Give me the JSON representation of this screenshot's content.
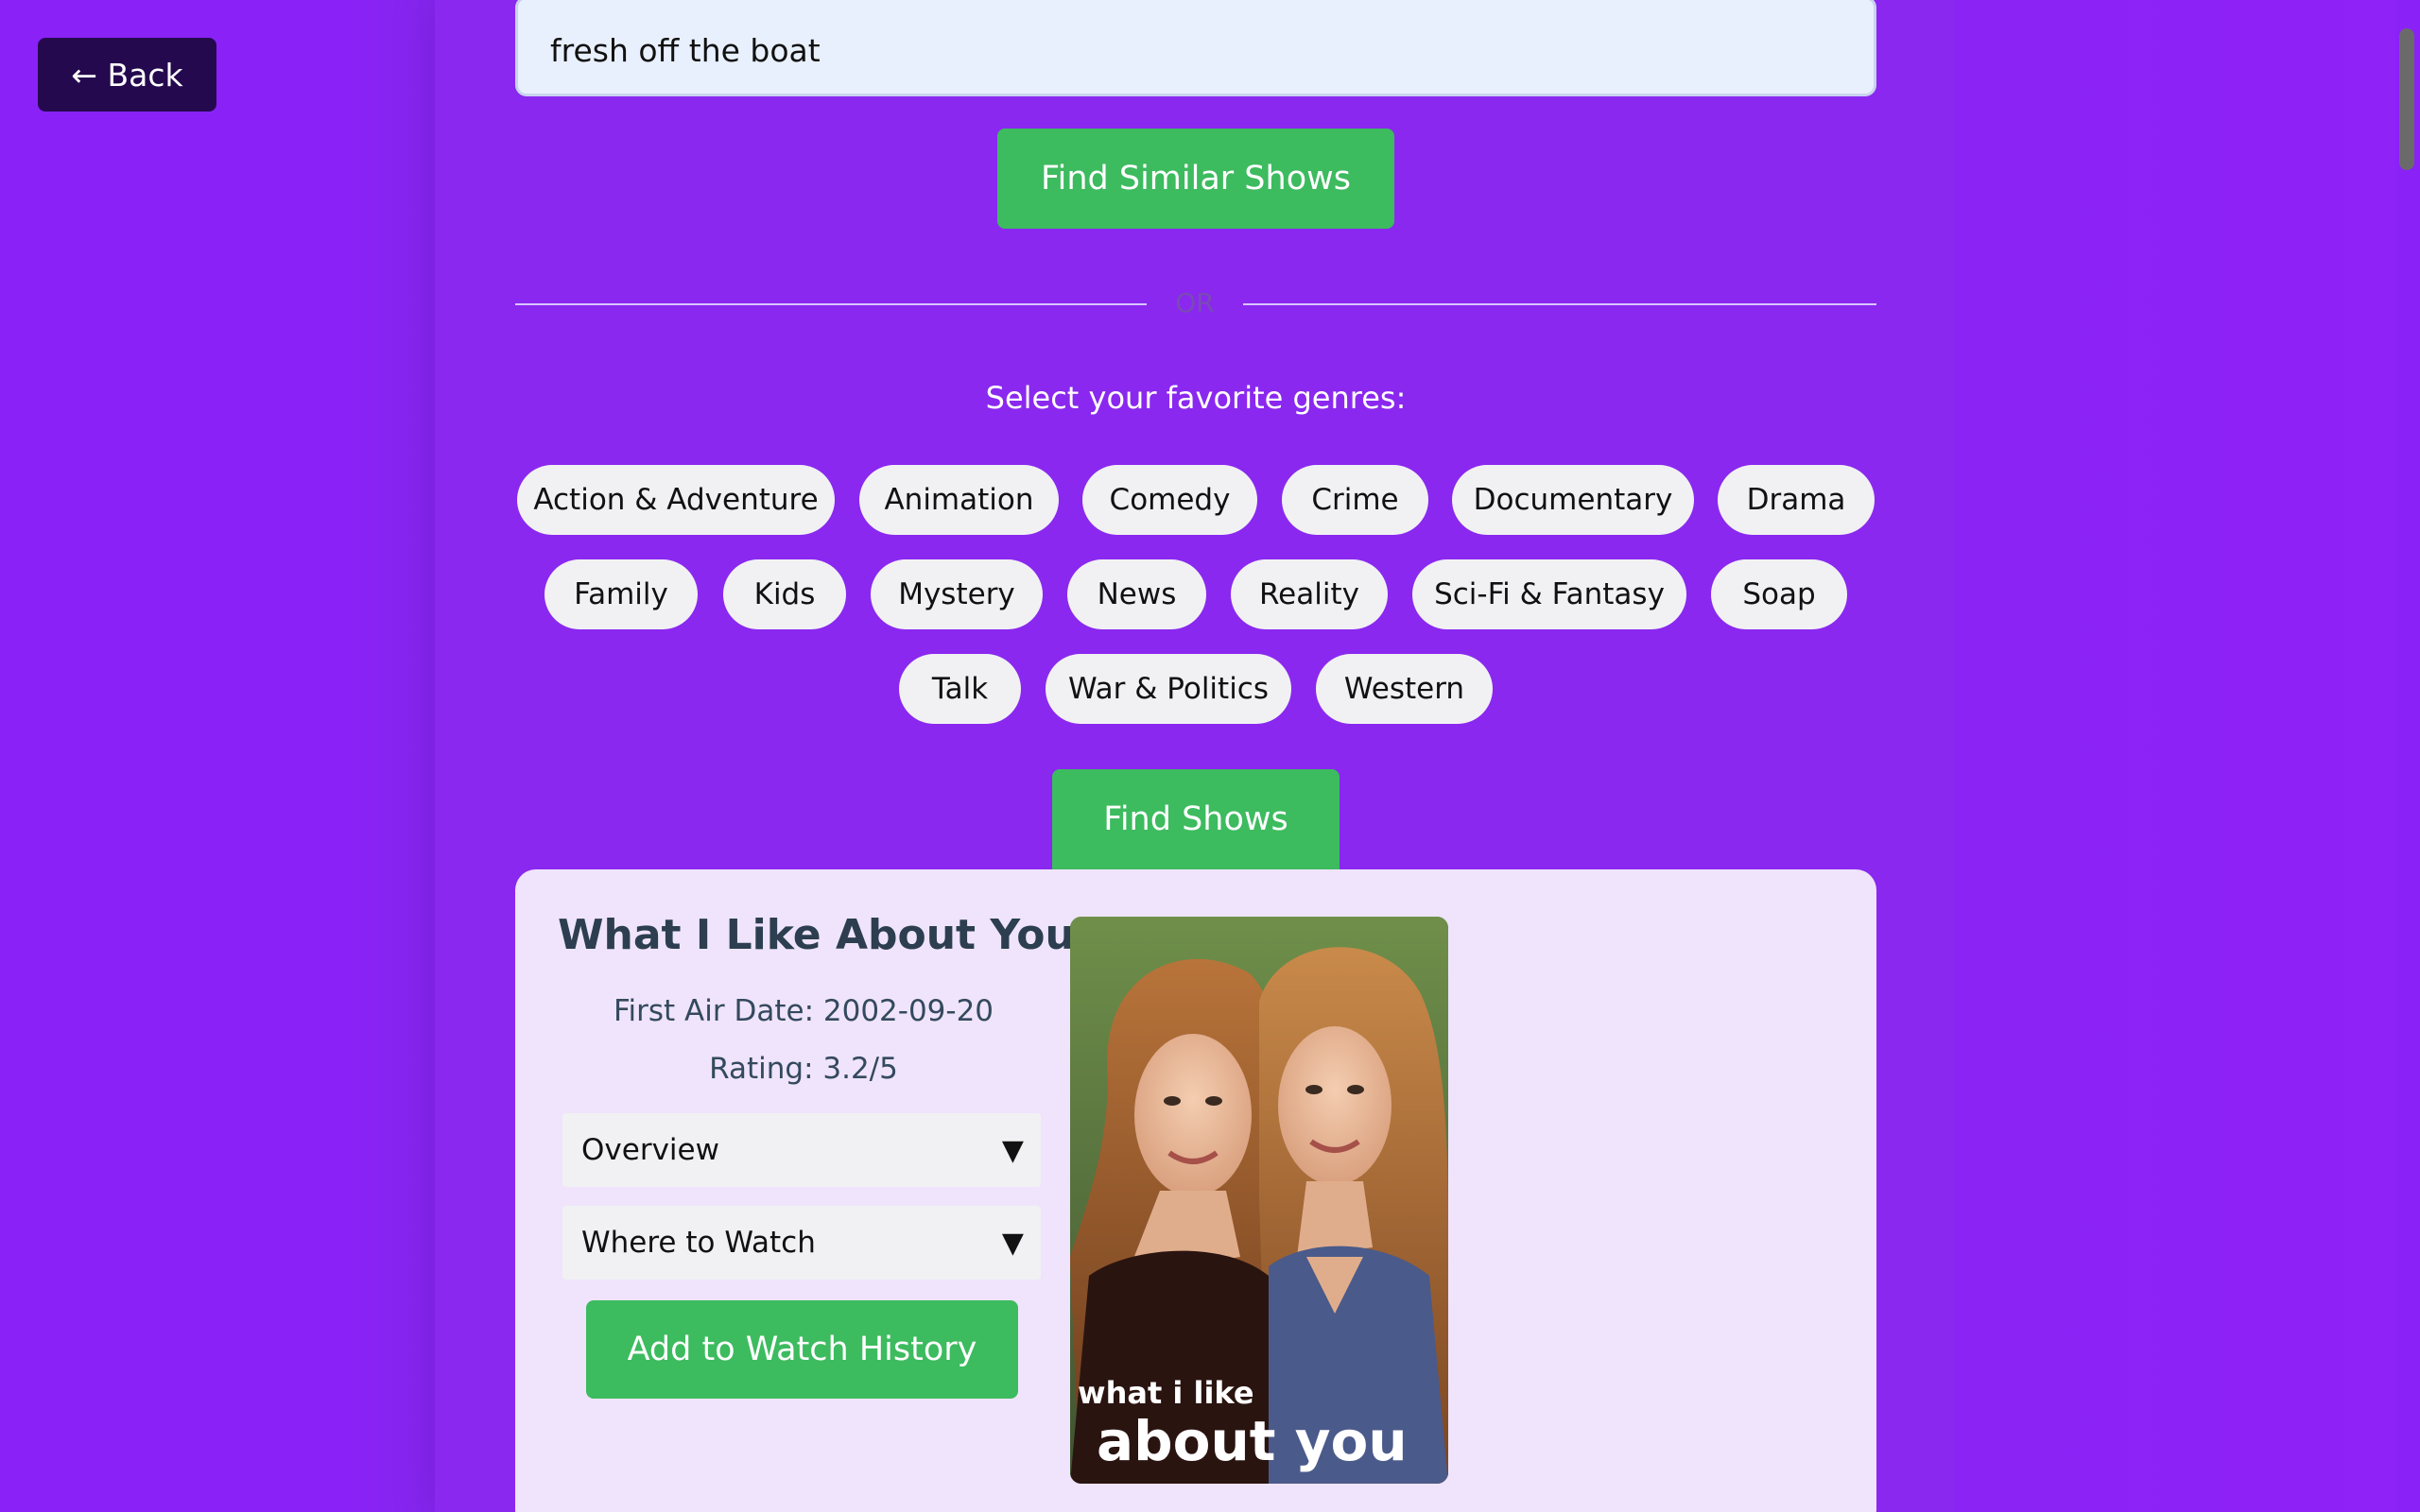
{
  "nav": {
    "back_label": "← Back"
  },
  "search": {
    "value": "fresh off the boat",
    "button_label": "Find Similar Shows"
  },
  "divider": {
    "label": "OR"
  },
  "genres": {
    "prompt": "Select your favorite genres:",
    "items": [
      "Action & Adventure",
      "Animation",
      "Comedy",
      "Crime",
      "Documentary",
      "Drama",
      "Family",
      "Kids",
      "Mystery",
      "News",
      "Reality",
      "Sci-Fi & Fantasy",
      "Soap",
      "Talk",
      "War & Politics",
      "Western"
    ],
    "button_label": "Find Shows"
  },
  "result": {
    "title": "What I Like About You",
    "first_air_date": "First Air Date: 2002-09-20",
    "rating": "Rating: 3.2/5",
    "overview_label": "Overview",
    "where_to_watch_label": "Where to Watch",
    "add_button_label": "Add to Watch History",
    "poster_text_line1": "what i like",
    "poster_text_line2": "about you"
  },
  "colors": {
    "background": "#8a22f7",
    "button_green": "#3dbb5f",
    "back_button": "#25094f",
    "card": "#efe4fb",
    "title": "#2c3e50"
  }
}
